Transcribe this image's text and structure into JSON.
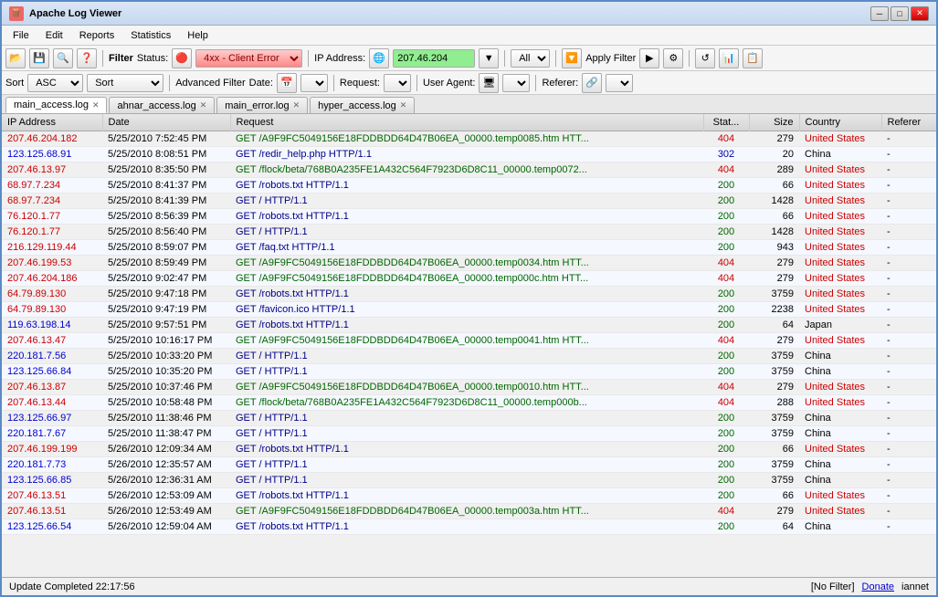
{
  "app": {
    "title": "Apache Log Viewer",
    "icon": "🪵"
  },
  "menu": {
    "items": [
      "File",
      "Edit",
      "Reports",
      "Statistics",
      "Help"
    ]
  },
  "toolbar1": {
    "filter_label": "Filter",
    "status_label": "Status:",
    "status_value": "4xx - Client Error",
    "ip_label": "IP Address:",
    "ip_value": "207.46.204",
    "all_label": "All",
    "apply_filter_label": "Apply Filter",
    "refresh_label": "↺"
  },
  "toolbar2": {
    "sort_label": "Sort",
    "asc_label": "ASC",
    "sort2_label": "Sort",
    "advanced_filter_label": "Advanced Filter",
    "date_label": "Date:",
    "request_label": "Request:",
    "user_agent_label": "User Agent:",
    "referer_label": "Referer:"
  },
  "tabs": [
    {
      "label": "main_access.log",
      "active": true
    },
    {
      "label": "ahnar_access.log",
      "active": false
    },
    {
      "label": "main_error.log",
      "active": false
    },
    {
      "label": "hyper_access.log",
      "active": false
    }
  ],
  "table": {
    "headers": [
      "IP Address",
      "Date",
      "Request",
      "Stat...",
      "Size",
      "Country",
      "Referer"
    ],
    "rows": [
      [
        "207.46.204.182",
        "5/25/2010 7:52:45 PM",
        "GET /A9F9FC5049156E18FDDBDD64D47B06EA_00000.temp0085.htm HTT...",
        "404",
        "279",
        "United States",
        "-"
      ],
      [
        "123.125.68.91",
        "5/25/2010 8:08:51 PM",
        "GET /redir_help.php HTTP/1.1",
        "302",
        "20",
        "China",
        "-"
      ],
      [
        "207.46.13.97",
        "5/25/2010 8:35:50 PM",
        "GET /flock/beta/768B0A235FE1A432C564F7923D6D8C11_00000.temp0072...",
        "404",
        "289",
        "United States",
        "-"
      ],
      [
        "68.97.7.234",
        "5/25/2010 8:41:37 PM",
        "GET /robots.txt HTTP/1.1",
        "200",
        "66",
        "United States",
        "-"
      ],
      [
        "68.97.7.234",
        "5/25/2010 8:41:39 PM",
        "GET / HTTP/1.1",
        "200",
        "1428",
        "United States",
        "-"
      ],
      [
        "76.120.1.77",
        "5/25/2010 8:56:39 PM",
        "GET /robots.txt HTTP/1.1",
        "200",
        "66",
        "United States",
        "-"
      ],
      [
        "76.120.1.77",
        "5/25/2010 8:56:40 PM",
        "GET / HTTP/1.1",
        "200",
        "1428",
        "United States",
        "-"
      ],
      [
        "216.129.119.44",
        "5/25/2010 8:59:07 PM",
        "GET /faq.txt HTTP/1.1",
        "200",
        "943",
        "United States",
        "-"
      ],
      [
        "207.46.199.53",
        "5/25/2010 8:59:49 PM",
        "GET /A9F9FC5049156E18FDDBDD64D47B06EA_00000.temp0034.htm HTT...",
        "404",
        "279",
        "United States",
        "-"
      ],
      [
        "207.46.204.186",
        "5/25/2010 9:02:47 PM",
        "GET /A9F9FC5049156E18FDDBDD64D47B06EA_00000.temp000c.htm HTT...",
        "404",
        "279",
        "United States",
        "-"
      ],
      [
        "64.79.89.130",
        "5/25/2010 9:47:18 PM",
        "GET /robots.txt HTTP/1.1",
        "200",
        "3759",
        "United States",
        "-"
      ],
      [
        "64.79.89.130",
        "5/25/2010 9:47:19 PM",
        "GET /favicon.ico HTTP/1.1",
        "200",
        "2238",
        "United States",
        "-"
      ],
      [
        "119.63.198.14",
        "5/25/2010 9:57:51 PM",
        "GET /robots.txt HTTP/1.1",
        "200",
        "64",
        "Japan",
        "-"
      ],
      [
        "207.46.13.47",
        "5/25/2010 10:16:17 PM",
        "GET /A9F9FC5049156E18FDDBDD64D47B06EA_00000.temp0041.htm HTT...",
        "404",
        "279",
        "United States",
        "-"
      ],
      [
        "220.181.7.56",
        "5/25/2010 10:33:20 PM",
        "GET / HTTP/1.1",
        "200",
        "3759",
        "China",
        "-"
      ],
      [
        "123.125.66.84",
        "5/25/2010 10:35:20 PM",
        "GET / HTTP/1.1",
        "200",
        "3759",
        "China",
        "-"
      ],
      [
        "207.46.13.87",
        "5/25/2010 10:37:46 PM",
        "GET /A9F9FC5049156E18FDDBDD64D47B06EA_00000.temp0010.htm HTT...",
        "404",
        "279",
        "United States",
        "-"
      ],
      [
        "207.46.13.44",
        "5/25/2010 10:58:48 PM",
        "GET /flock/beta/768B0A235FE1A432C564F7923D6D8C11_00000.temp000b...",
        "404",
        "288",
        "United States",
        "-"
      ],
      [
        "123.125.66.97",
        "5/25/2010 11:38:46 PM",
        "GET / HTTP/1.1",
        "200",
        "3759",
        "China",
        "-"
      ],
      [
        "220.181.7.67",
        "5/25/2010 11:38:47 PM",
        "GET / HTTP/1.1",
        "200",
        "3759",
        "China",
        "-"
      ],
      [
        "207.46.199.199",
        "5/26/2010 12:09:34 AM",
        "GET /robots.txt HTTP/1.1",
        "200",
        "66",
        "United States",
        "-"
      ],
      [
        "220.181.7.73",
        "5/26/2010 12:35:57 AM",
        "GET / HTTP/1.1",
        "200",
        "3759",
        "China",
        "-"
      ],
      [
        "123.125.66.85",
        "5/26/2010 12:36:31 AM",
        "GET / HTTP/1.1",
        "200",
        "3759",
        "China",
        "-"
      ],
      [
        "207.46.13.51",
        "5/26/2010 12:53:09 AM",
        "GET /robots.txt HTTP/1.1",
        "200",
        "66",
        "United States",
        "-"
      ],
      [
        "207.46.13.51",
        "5/26/2010 12:53:49 AM",
        "GET /A9F9FC5049156E18FDDBDD64D47B06EA_00000.temp003a.htm HTT...",
        "404",
        "279",
        "United States",
        "-"
      ],
      [
        "123.125.66.54",
        "5/26/2010 12:59:04 AM",
        "GET /robots.txt HTTP/1.1",
        "200",
        "64",
        "China",
        "-"
      ]
    ]
  },
  "status_bar": {
    "update_text": "Update Completed 22:17:56",
    "filter_text": "[No Filter]",
    "donate_text": "Donate",
    "app_text": "iannet"
  },
  "scrollbar": {
    "visible": true
  }
}
